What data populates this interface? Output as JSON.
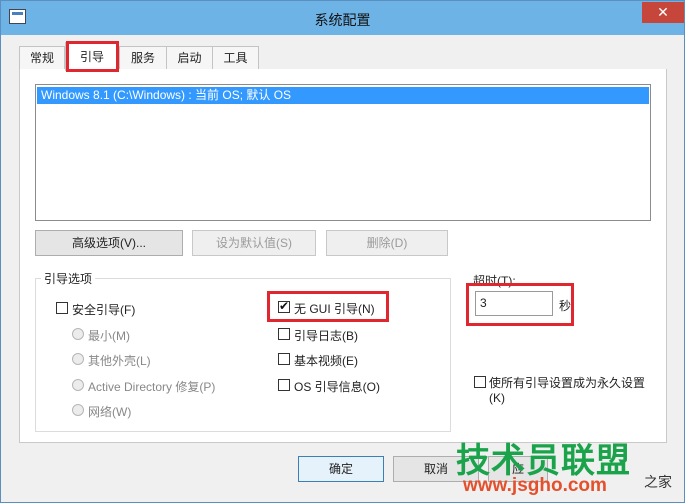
{
  "window": {
    "title": "系统配置",
    "close_glyph": "✕"
  },
  "tabs": [
    {
      "label": "常规"
    },
    {
      "label": "引导"
    },
    {
      "label": "服务"
    },
    {
      "label": "启动"
    },
    {
      "label": "工具"
    }
  ],
  "boot_list": {
    "entries": [
      "Windows 8.1 (C:\\Windows) : 当前 OS; 默认 OS"
    ]
  },
  "buttons": {
    "advanced": "高级选项(V)...",
    "set_default": "设为默认值(S)",
    "delete": "删除(D)"
  },
  "boot_options": {
    "legend": "引导选项",
    "safe_boot": "安全引导(F)",
    "minimal": "最小(M)",
    "alternate_shell": "其他外壳(L)",
    "active_directory": "Active Directory 修复(P)",
    "network": "网络(W)",
    "no_gui_boot": "无 GUI 引导(N)",
    "boot_log": "引导日志(B)",
    "base_video": "基本视频(E)",
    "os_boot_info": "OS 引导信息(O)"
  },
  "timeout": {
    "label": "超时(T):",
    "value": "3",
    "unit": "秒"
  },
  "make_permanent": {
    "line1": "使所有引导设置成为永久设置",
    "line2": "(K)"
  },
  "footer": {
    "ok": "确定",
    "cancel": "取消",
    "apply": "应"
  },
  "watermark": {
    "main": "技术员联盟",
    "url": "www.jsgho.com",
    "small": "之家"
  },
  "colors": {
    "titlebar": "#6eb3e6",
    "selection": "#3399ff",
    "highlight_box": "#e0262e",
    "close": "#c7463b"
  }
}
